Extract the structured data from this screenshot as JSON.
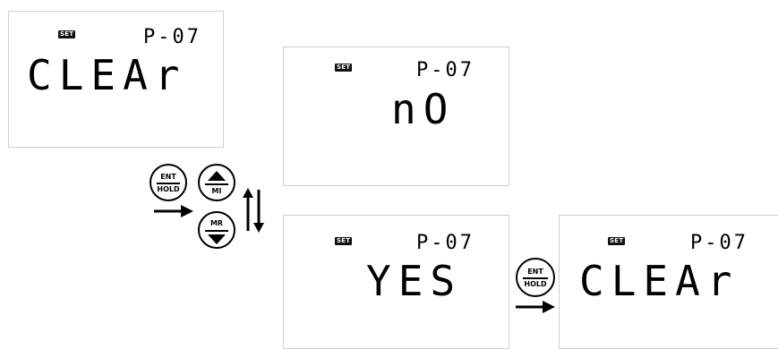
{
  "screens": [
    {
      "set_label": "SET",
      "param": "P-07",
      "value": "CLEAr"
    },
    {
      "set_label": "SET",
      "param": "P-07",
      "value": "nO"
    },
    {
      "set_label": "SET",
      "param": "P-07",
      "value": "YES"
    },
    {
      "set_label": "SET",
      "param": "P-07",
      "value": "CLEAr"
    }
  ],
  "buttons": {
    "ent_hold_top": "ENT",
    "ent_hold_bottom": "HOLD",
    "up_label": "MI",
    "down_label": "MR",
    "ent_hold2_top": "ENT",
    "ent_hold2_bottom": "HOLD"
  },
  "icons": [
    "right-arrow-icon",
    "up-triangle-icon",
    "down-triangle-icon",
    "up-down-arrows-icon"
  ]
}
